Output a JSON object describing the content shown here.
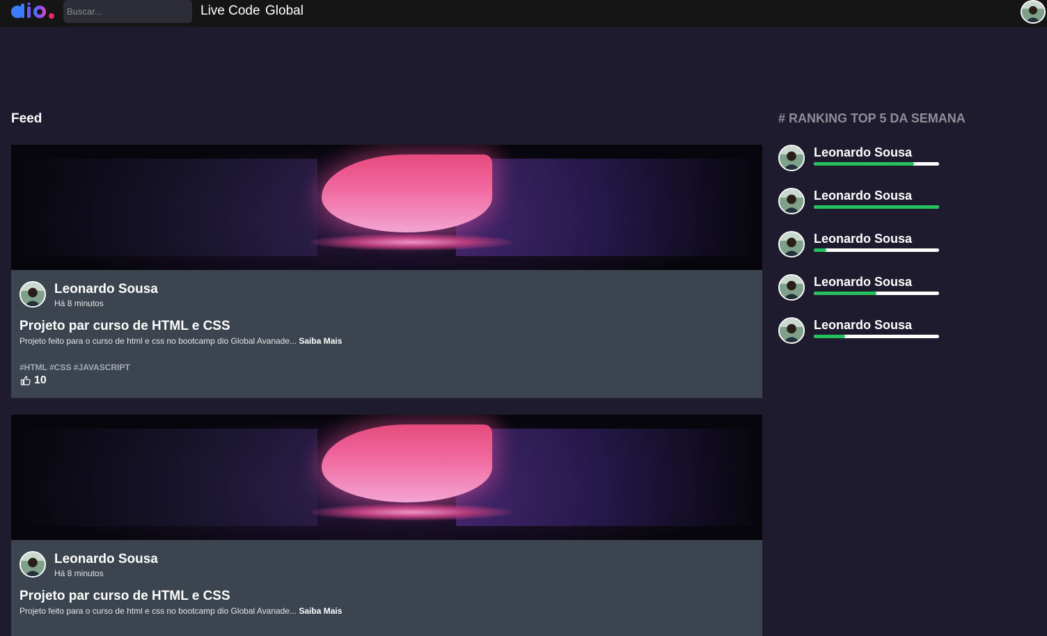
{
  "header": {
    "search_placeholder": "Buscar...",
    "nav": [
      {
        "label": "Live Code"
      },
      {
        "label": "Global"
      }
    ]
  },
  "feed": {
    "title": "Feed",
    "posts": [
      {
        "author": "Leonardo Sousa",
        "time": "Há 8 minutos",
        "title": "Projeto par curso de HTML e CSS",
        "description": "Projeto feito para o curso de html e css no bootcamp dio Global Avanade...",
        "more_label": "Saiba Mais",
        "tags": "#HTML #CSS #JAVASCRIPT",
        "likes": "10"
      },
      {
        "author": "Leonardo Sousa",
        "time": "Há 8 minutos",
        "title": "Projeto par curso de HTML e CSS",
        "description": "Projeto feito para o curso de html e css no bootcamp dio Global Avanade...",
        "more_label": "Saiba Mais"
      }
    ]
  },
  "ranking": {
    "title": "# RANKING TOP 5 DA SEMANA",
    "items": [
      {
        "name": "Leonardo Sousa",
        "progress": 0.8
      },
      {
        "name": "Leonardo Sousa",
        "progress": 1.0
      },
      {
        "name": "Leonardo Sousa",
        "progress": 0.1
      },
      {
        "name": "Leonardo Sousa",
        "progress": 0.5
      },
      {
        "name": "Leonardo Sousa",
        "progress": 0.25
      }
    ]
  },
  "colors": {
    "progress_fill": "#25c15f",
    "card_bg": "#3b444f",
    "page_bg": "#1f1b2e"
  }
}
